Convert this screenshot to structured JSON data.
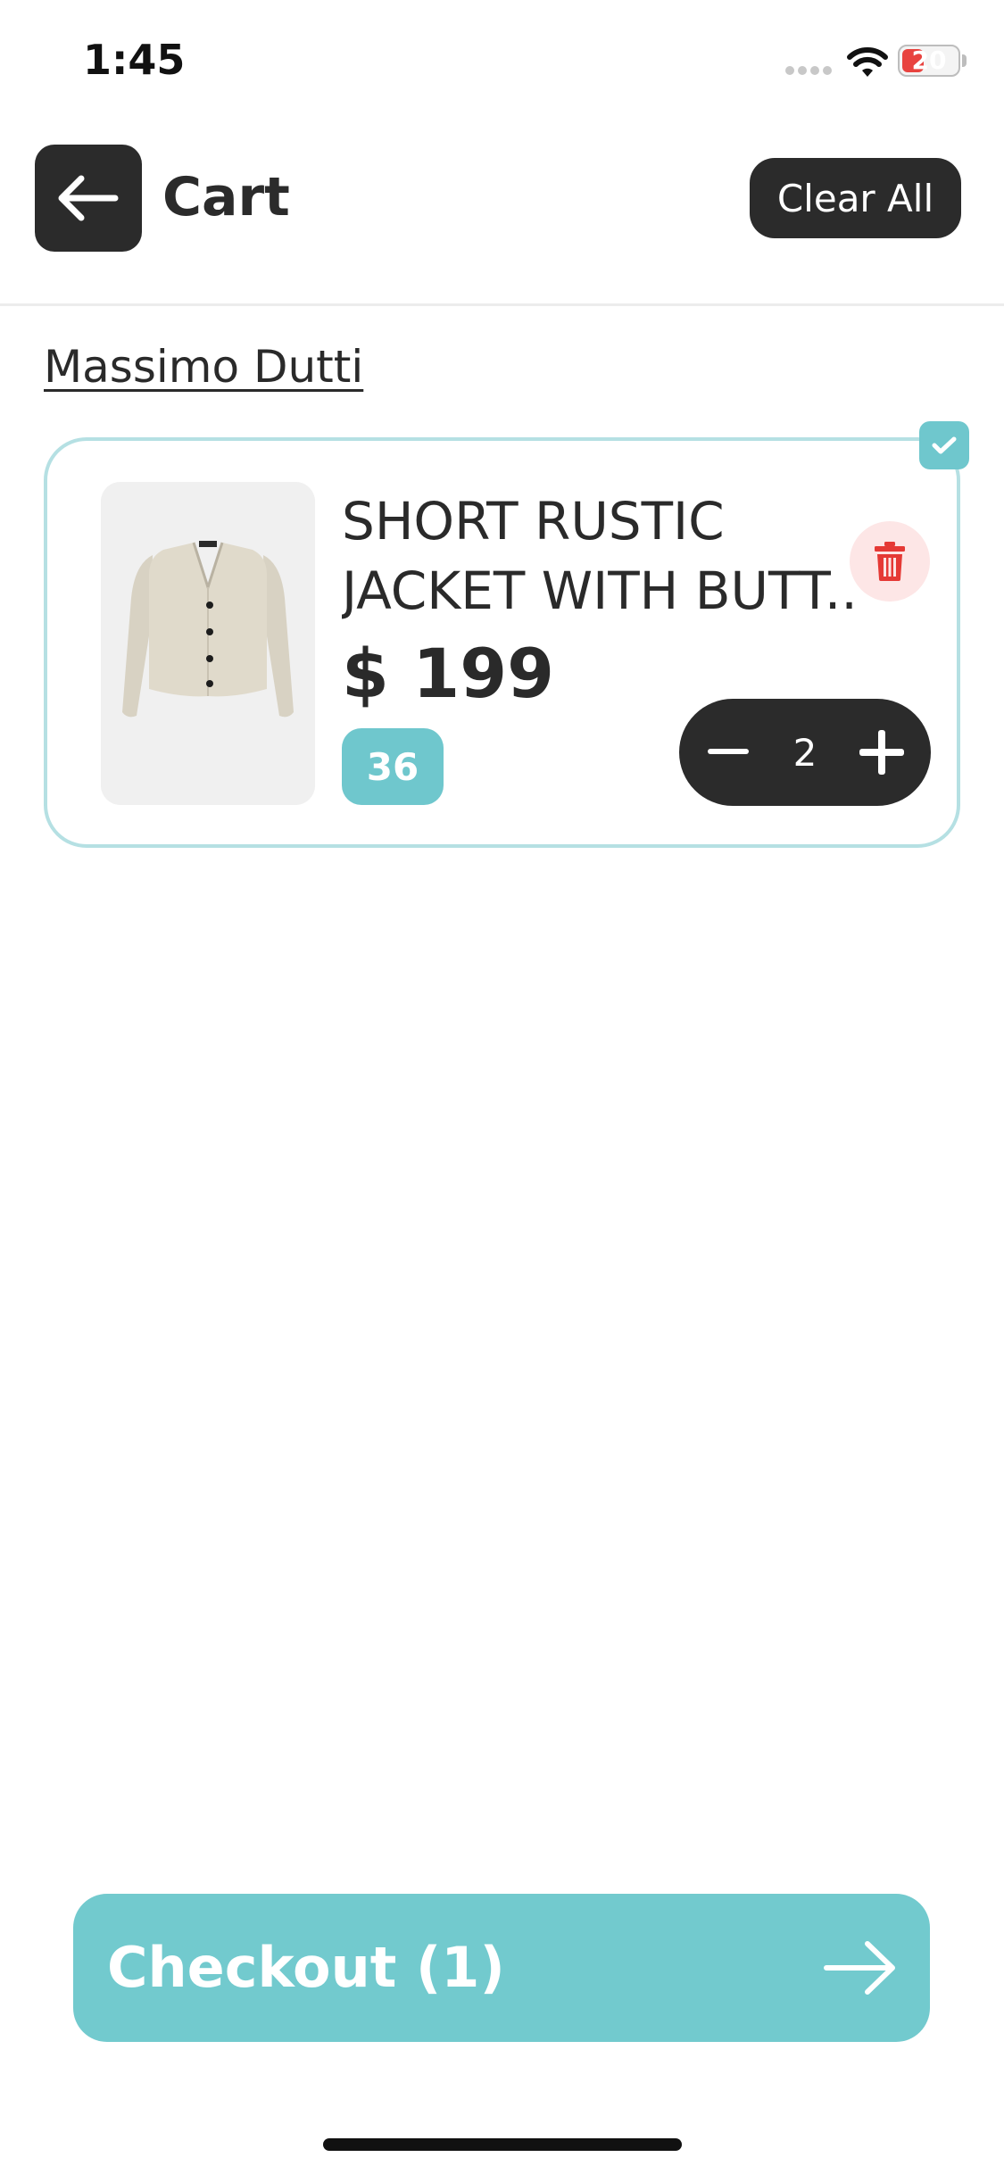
{
  "status_bar": {
    "time": "1:45",
    "battery": "20"
  },
  "header": {
    "title": "Cart",
    "clear_all_label": "Clear All"
  },
  "store": {
    "name": "Massimo Dutti"
  },
  "cart_item": {
    "name_line1": "SHORT RUSTIC",
    "name_line2": "JACKET WITH BUTT...",
    "price": "$ 199",
    "size": "36",
    "quantity": "2",
    "selected": true
  },
  "checkout": {
    "label": "Checkout (1)"
  },
  "colors": {
    "accent": "#72cace",
    "dark": "#2b2b2b",
    "card_border": "#b5e0e3",
    "delete_red": "#e53935",
    "delete_bg": "#fde6e6"
  },
  "icons": {
    "back": "arrow-left-icon",
    "delete": "trash-icon",
    "minus": "minus-icon",
    "plus": "plus-icon",
    "checkout": "arrow-right-icon",
    "checkbox": "checkmark-icon",
    "wifi": "wifi-icon"
  }
}
